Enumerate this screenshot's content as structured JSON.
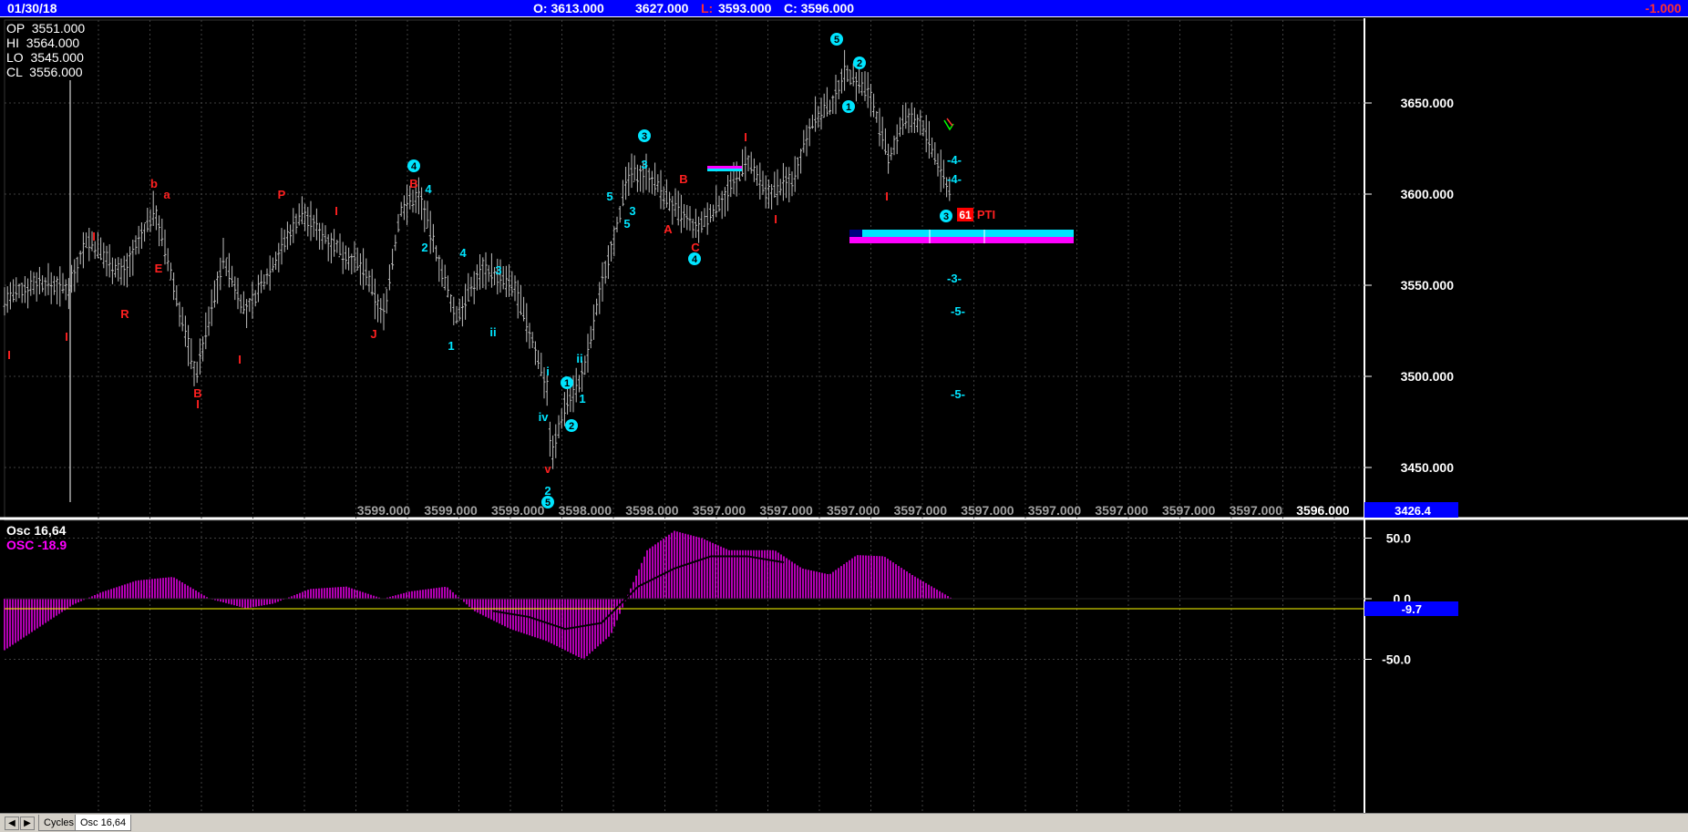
{
  "header": {
    "date": "01/30/18",
    "open_text": "O: 3613.000",
    "high_text": "3627.000",
    "low_label": "L:",
    "low_value": "3593.000",
    "close_text": "C: 3596.000",
    "change": "-1.000"
  },
  "ohlc_panel": [
    {
      "label": "OP",
      "value": "3551.000"
    },
    {
      "label": "HI",
      "value": "3564.000"
    },
    {
      "label": "LO",
      "value": "3545.000"
    },
    {
      "label": "CL",
      "value": "3556.000"
    }
  ],
  "price_axis": {
    "ticks": [
      "3650.000",
      "3600.000",
      "3550.000",
      "3500.000",
      "3450.000"
    ],
    "current_value": "3426.4"
  },
  "time_axis": {
    "labels": [
      "3599.000",
      "3599.000",
      "3599.000",
      "3598.000",
      "3598.000",
      "3597.000",
      "3597.000",
      "3597.000",
      "3597.000",
      "3597.000",
      "3597.000",
      "3597.000",
      "3597.000",
      "3597.000",
      "3596.000"
    ]
  },
  "wave_labels_red": [
    "I",
    "I",
    "I",
    "R",
    "b",
    "a",
    "E",
    "B",
    "I",
    "P",
    "I",
    "J",
    "B",
    "A",
    "B",
    "C",
    "I",
    "I",
    "I",
    "v"
  ],
  "wave_labels_cyan": [
    "4",
    "2",
    "1",
    "4",
    "3",
    "ii",
    "i",
    "iv",
    "ii",
    "1",
    "2",
    "5",
    "3",
    "4",
    "3",
    "5",
    "1",
    "2",
    "4",
    "5",
    "2",
    "1",
    "3",
    "-4-",
    "-4-",
    "-3-",
    "-5-",
    "-5-"
  ],
  "circled_labels_cyan": [
    "4",
    "3",
    "4",
    "1",
    "2",
    "5",
    "5",
    "2",
    "1",
    "3"
  ],
  "pti": {
    "badge": "61",
    "label": "PTI"
  },
  "oscillator": {
    "title": "Osc 16,64",
    "value_label": "OSC -18.9",
    "ticks": [
      "50.0",
      "0.0",
      "-50.0"
    ],
    "current_value": "-9.7"
  },
  "tabs": [
    {
      "label": "Cycles"
    },
    {
      "label": "Osc 16,64"
    }
  ],
  "colors": {
    "header_bg": "#0000ff",
    "bars": "#c0c0c0",
    "wave_red": "#ff2020",
    "wave_cyan": "#00e5ff",
    "osc": "#ff00ff",
    "zero_line": "#ffff00",
    "value_box": "#0000ff"
  },
  "chart_data": {
    "type": "bar",
    "xlabel": "",
    "ylabel": "",
    "ylim": [
      3415,
      3695
    ],
    "price_path": [
      [
        0,
        3540
      ],
      [
        40,
        3552
      ],
      [
        75,
        3548
      ],
      [
        95,
        3575
      ],
      [
        135,
        3556
      ],
      [
        170,
        3592
      ],
      [
        215,
        3500
      ],
      [
        245,
        3565
      ],
      [
        270,
        3535
      ],
      [
        300,
        3562
      ],
      [
        330,
        3590
      ],
      [
        360,
        3575
      ],
      [
        400,
        3558
      ],
      [
        420,
        3532
      ],
      [
        440,
        3592
      ],
      [
        460,
        3600
      ],
      [
        485,
        3557
      ],
      [
        500,
        3532
      ],
      [
        530,
        3560
      ],
      [
        565,
        3548
      ],
      [
        600,
        3495
      ],
      [
        605,
        3455
      ],
      [
        620,
        3485
      ],
      [
        640,
        3500
      ],
      [
        660,
        3550
      ],
      [
        690,
        3610
      ],
      [
        710,
        3612
      ],
      [
        740,
        3592
      ],
      [
        765,
        3580
      ],
      [
        800,
        3602
      ],
      [
        820,
        3618
      ],
      [
        840,
        3600
      ],
      [
        870,
        3608
      ],
      [
        890,
        3640
      ],
      [
        915,
        3650
      ],
      [
        925,
        3668
      ],
      [
        945,
        3660
      ],
      [
        955,
        3655
      ],
      [
        975,
        3618
      ],
      [
        990,
        3640
      ],
      [
        1010,
        3640
      ],
      [
        1030,
        3615
      ],
      [
        1045,
        3598
      ]
    ],
    "projection_band": {
      "from_index": 932,
      "to_index": 1178,
      "top": 3578,
      "bottom": 3571
    },
    "oscillator_series": [
      [
        0,
        -45
      ],
      [
        40,
        -25
      ],
      [
        80,
        -5
      ],
      [
        110,
        5
      ],
      [
        150,
        15
      ],
      [
        190,
        18
      ],
      [
        230,
        0
      ],
      [
        270,
        -8
      ],
      [
        300,
        -4
      ],
      [
        340,
        8
      ],
      [
        380,
        10
      ],
      [
        420,
        0
      ],
      [
        450,
        6
      ],
      [
        490,
        10
      ],
      [
        520,
        -10
      ],
      [
        560,
        -25
      ],
      [
        600,
        -35
      ],
      [
        640,
        -50
      ],
      [
        670,
        -30
      ],
      [
        690,
        5
      ],
      [
        710,
        40
      ],
      [
        740,
        56
      ],
      [
        770,
        50
      ],
      [
        800,
        40
      ],
      [
        850,
        40
      ],
      [
        880,
        25
      ],
      [
        910,
        20
      ],
      [
        940,
        36
      ],
      [
        970,
        35
      ],
      [
        1000,
        20
      ],
      [
        1045,
        0
      ]
    ],
    "oscillator_smooth": [
      [
        540,
        -10
      ],
      [
        580,
        -15
      ],
      [
        620,
        -25
      ],
      [
        660,
        -20
      ],
      [
        700,
        10
      ],
      [
        740,
        25
      ],
      [
        780,
        35
      ],
      [
        820,
        35
      ],
      [
        860,
        30
      ]
    ]
  }
}
